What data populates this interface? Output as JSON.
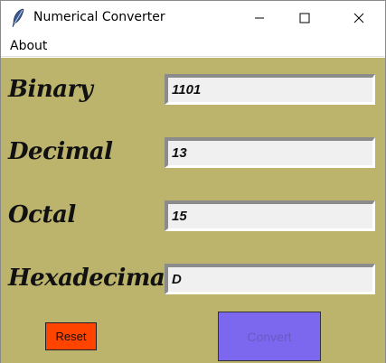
{
  "window": {
    "title": "Numerical Converter",
    "icon": "feather-icon"
  },
  "menu": {
    "items": [
      "About"
    ]
  },
  "fields": [
    {
      "label": "Binary",
      "value": "1101"
    },
    {
      "label": "Decimal",
      "value": "13"
    },
    {
      "label": "Octal",
      "value": "15"
    },
    {
      "label": "Hexadecimal",
      "value": "D"
    }
  ],
  "buttons": {
    "reset": "Reset",
    "convert": "Convert"
  },
  "colors": {
    "background": "#bcb46d",
    "reset": "#ff4400",
    "convert": "#7b68ee"
  }
}
